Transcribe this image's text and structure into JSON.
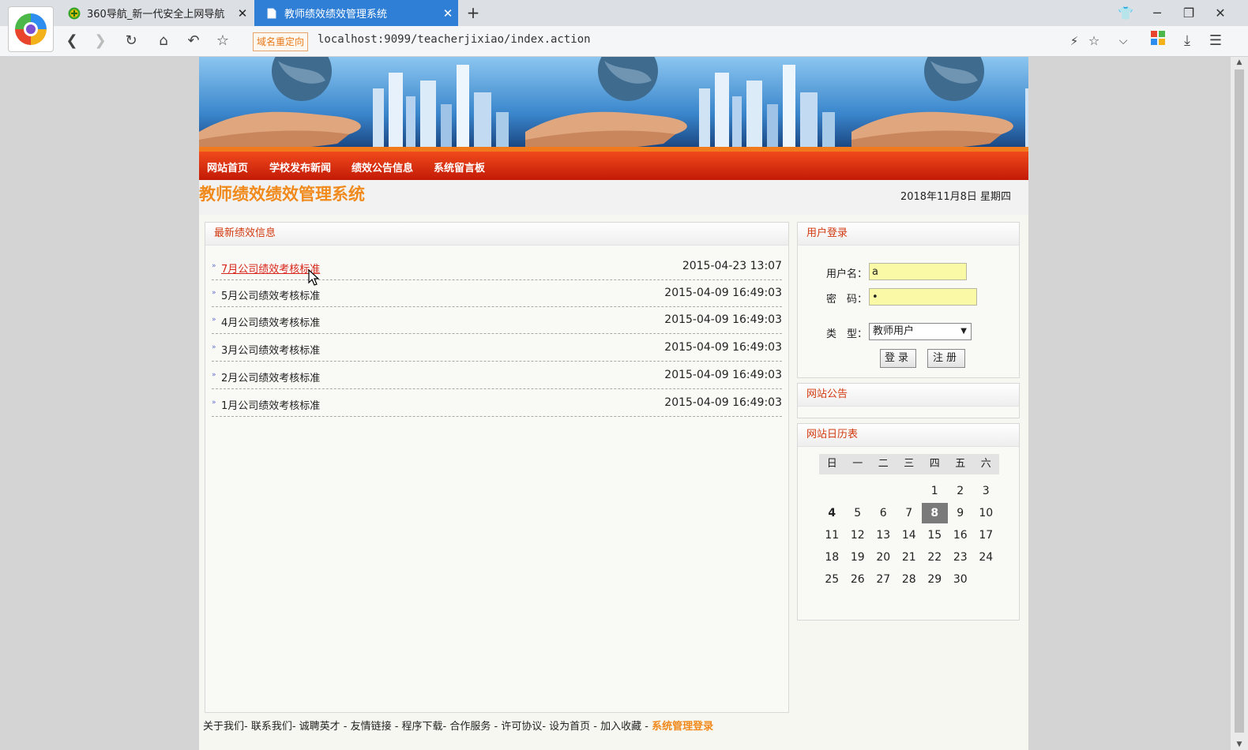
{
  "browser": {
    "tabs": [
      {
        "label": "360导航_新一代安全上网导航",
        "active": false
      },
      {
        "label": "教师绩效绩效管理系统",
        "active": true
      }
    ],
    "redirect_badge": "域名重定向",
    "url": "localhost:9099/teacherjixiao/index.action",
    "accent_color": "#2f7fd6"
  },
  "site": {
    "nav": [
      "网站首页",
      "学校发布新闻",
      "绩效公告信息",
      "系统留言板"
    ],
    "title": "教师绩效绩效管理系统",
    "date": "2018年11月8日 星期四",
    "accent_color": "#f08a1c",
    "nav_color": "#d8261a"
  },
  "news": {
    "heading": "最新绩效信息",
    "items": [
      {
        "title": "7月公司绩效考核标准",
        "time": "2015-04-23 13:07",
        "hovered": true
      },
      {
        "title": "5月公司绩效考核标准",
        "time": "2015-04-09 16:49:03"
      },
      {
        "title": "4月公司绩效考核标准",
        "time": "2015-04-09 16:49:03"
      },
      {
        "title": "3月公司绩效考核标准",
        "time": "2015-04-09 16:49:03"
      },
      {
        "title": "2月公司绩效考核标准",
        "time": "2015-04-09 16:49:03"
      },
      {
        "title": "1月公司绩效考核标准",
        "time": "2015-04-09 16:49:03"
      }
    ]
  },
  "login": {
    "heading": "用户登录",
    "username_label": "用户名：",
    "username_value": "a",
    "password_label": "密　码：",
    "password_value": "•",
    "type_label": "类　型：",
    "type_value": "教师用户",
    "login_button": "登录",
    "register_button": "注册"
  },
  "notice": {
    "heading": "网站公告"
  },
  "calendar": {
    "heading": "网站日历表",
    "weekdays": [
      "日",
      "一",
      "二",
      "三",
      "四",
      "五",
      "六"
    ],
    "weeks": [
      [
        "",
        "",
        "",
        "",
        "1",
        "2",
        "3"
      ],
      [
        "4",
        "5",
        "6",
        "7",
        "8",
        "9",
        "10"
      ],
      [
        "11",
        "12",
        "13",
        "14",
        "15",
        "16",
        "17"
      ],
      [
        "18",
        "19",
        "20",
        "21",
        "22",
        "23",
        "24"
      ],
      [
        "25",
        "26",
        "27",
        "28",
        "29",
        "30",
        ""
      ]
    ],
    "today": "8"
  },
  "footer": {
    "links": "关于我们- 联系我们- 诚聘英才 - 友情链接 - 程序下载- 合作服务 - 许可协议- 设为首页 - 加入收藏 -",
    "admin_link": "系统管理登录"
  }
}
